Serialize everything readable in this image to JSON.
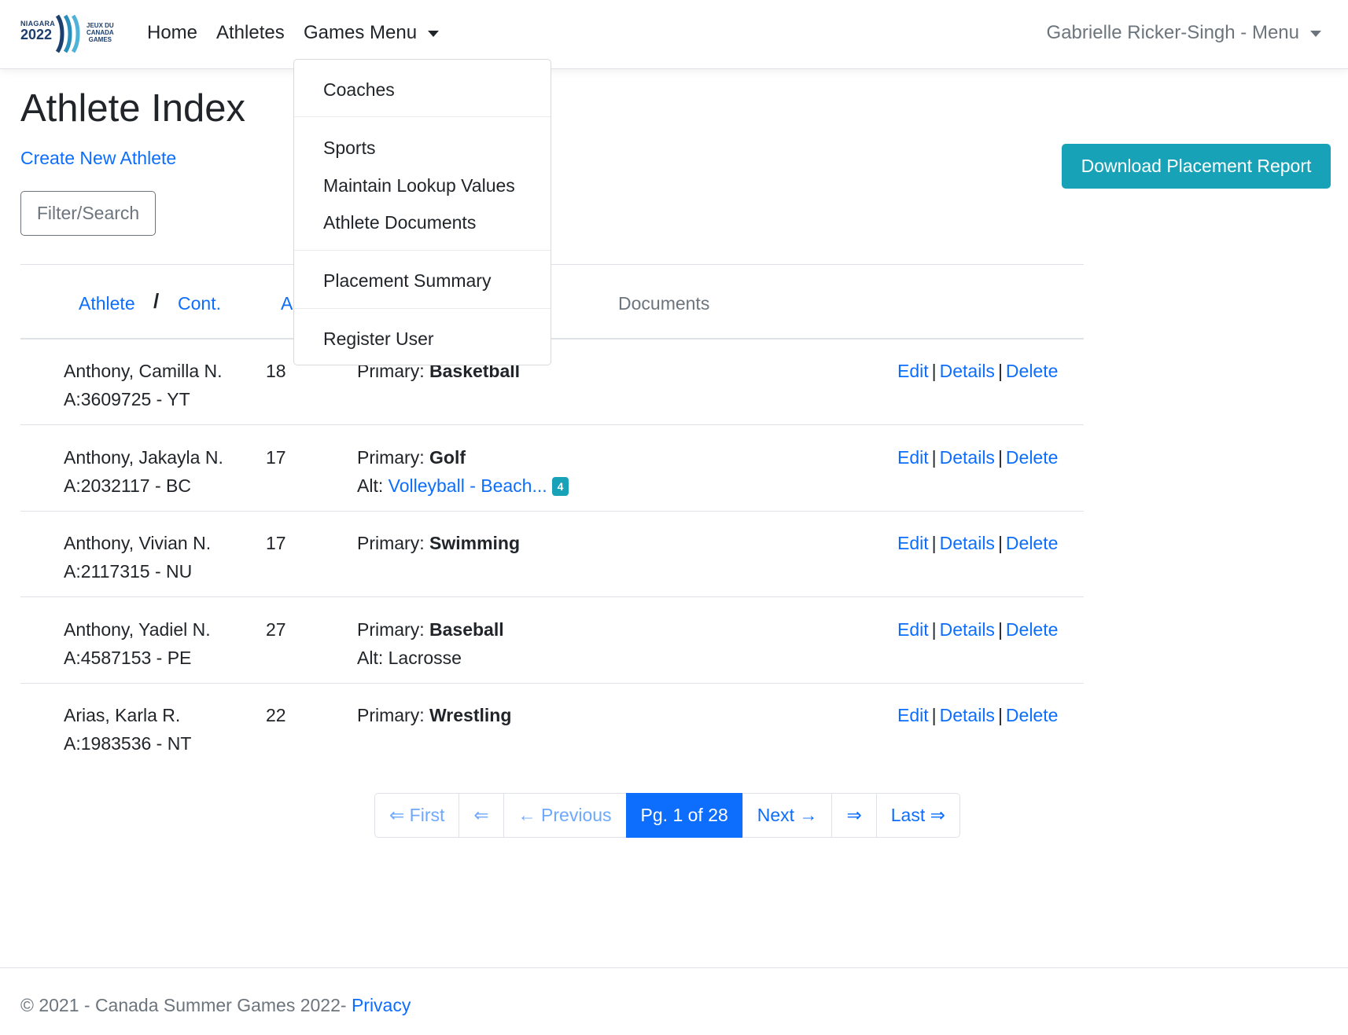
{
  "brand": {
    "left_line1": "NIAGARA",
    "left_line2": "2022",
    "right_line1": "JEUX DU",
    "right_line2": "CANADA",
    "right_line3": "GAMES"
  },
  "nav": {
    "home": "Home",
    "athletes": "Athletes",
    "games_menu": "Games Menu",
    "user_menu": "Gabrielle Ricker-Singh - Menu"
  },
  "dropdown": {
    "items": [
      "Coaches",
      "Sports",
      "Maintain Lookup Values",
      "Athlete Documents",
      "Placement Summary",
      "Register User"
    ]
  },
  "page": {
    "title": "Athlete Index",
    "create_link": "Create New Athlete",
    "filter_button": "Filter/Search",
    "download_button": "Download Placement Report"
  },
  "table": {
    "headers": {
      "athlete": "Athlete",
      "slash": "/",
      "cont": "Cont.",
      "age_partial": "A",
      "documents": "Documents"
    },
    "rows": [
      {
        "name": "Anthony, Camilla N.",
        "id_cont": "A:3609725 - YT",
        "age": "18",
        "primary_label": "Primary: ",
        "primary": "Basketball",
        "alt_label": "",
        "alt": "",
        "alt_badge": ""
      },
      {
        "name": "Anthony, Jakayla N.",
        "id_cont": "A:2032117 - BC",
        "age": "17",
        "primary_label": "Primary: ",
        "primary": "Golf",
        "alt_label": "Alt: ",
        "alt": "Volleyball - Beach...",
        "alt_badge": "4"
      },
      {
        "name": "Anthony, Vivian N.",
        "id_cont": "A:2117315 - NU",
        "age": "17",
        "primary_label": "Primary: ",
        "primary": "Swimming",
        "alt_label": "",
        "alt": "",
        "alt_badge": ""
      },
      {
        "name": "Anthony, Yadiel N.",
        "id_cont": "A:4587153 - PE",
        "age": "27",
        "primary_label": "Primary: ",
        "primary": "Baseball",
        "alt_label": "Alt: ",
        "alt": "Lacrosse",
        "alt_badge": ""
      },
      {
        "name": "Arias, Karla R.",
        "id_cont": "A:1983536 - NT",
        "age": "22",
        "primary_label": "Primary: ",
        "primary": "Wrestling",
        "alt_label": "",
        "alt": "",
        "alt_badge": ""
      }
    ],
    "actions": {
      "edit": "Edit",
      "details": "Details",
      "delete": "Delete",
      "separator": "|"
    }
  },
  "pagination": {
    "first": "⇐ First",
    "back_arrow": "⇐",
    "previous": "← Previous",
    "current": "Pg. 1 of 28",
    "next": "Next →",
    "forward_arrow": "⇒",
    "last": "Last ⇒"
  },
  "footer": {
    "text": "© 2021 - Canada Summer Games 2022- ",
    "privacy": "Privacy"
  },
  "colors": {
    "link": "#0d6efd",
    "info": "#17a2b8",
    "brand_navy": "#1c3f6e"
  }
}
